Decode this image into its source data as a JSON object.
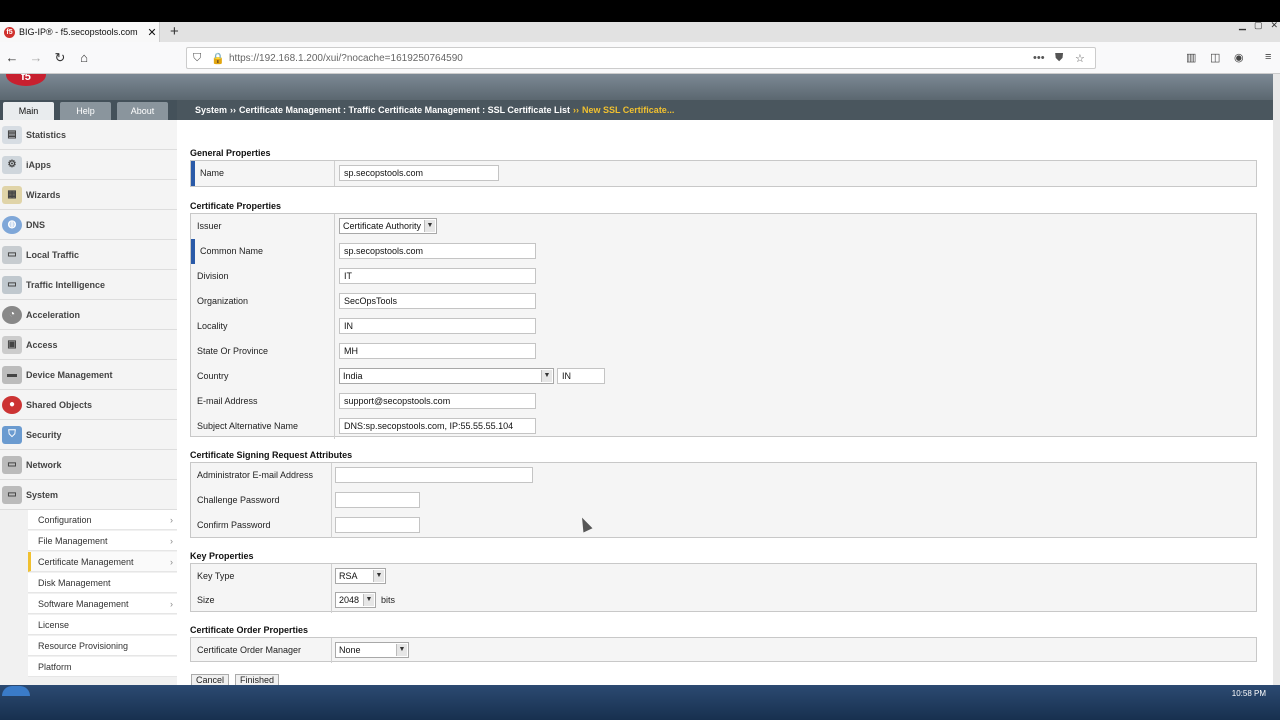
{
  "browser": {
    "tab_title": "BIG-IP® - f5.secopstools.com",
    "tab_favicon": "f5",
    "new_tab": "+",
    "url_host": "https://192.168.1.200",
    "url_path": "/xui/?nocache=1619250764590"
  },
  "app": {
    "logo_text": "f5",
    "nav_tabs": [
      "Main",
      "Help",
      "About"
    ],
    "breadcrumb": {
      "part1": "System",
      "sep": "››",
      "part2": "Certificate Management : Traffic Certificate Management : SSL Certificate List",
      "current": "New SSL Certificate..."
    }
  },
  "sidebar": {
    "items": [
      "Statistics",
      "iApps",
      "Wizards",
      "DNS",
      "Local Traffic",
      "Traffic Intelligence",
      "Acceleration",
      "Access",
      "Device Management",
      "Shared Objects",
      "Security",
      "Network",
      "System"
    ],
    "submenu": [
      "Configuration",
      "File Management",
      "Certificate Management",
      "Disk Management",
      "Software Management",
      "License",
      "Resource Provisioning",
      "Platform"
    ]
  },
  "form": {
    "general_title": "General Properties",
    "name_label": "Name",
    "name_value": "sp.secopstools.com",
    "cert_title": "Certificate Properties",
    "issuer_label": "Issuer",
    "issuer_value": "Certificate Authority",
    "common_name_label": "Common Name",
    "common_name_value": "sp.secopstools.com",
    "division_label": "Division",
    "division_value": "IT",
    "organization_label": "Organization",
    "organization_value": "SecOpsTools",
    "locality_label": "Locality",
    "locality_value": "IN",
    "state_label": "State Or Province",
    "state_value": "MH",
    "country_label": "Country",
    "country_value": "India",
    "country_code": "IN",
    "email_label": "E-mail Address",
    "email_value": "support@secopstools.com",
    "san_label": "Subject Alternative Name",
    "san_value": "DNS:sp.secopstools.com, IP:55.55.55.104",
    "csr_title": "Certificate Signing Request Attributes",
    "admin_email_label": "Administrator E-mail Address",
    "challenge_label": "Challenge Password",
    "confirm_label": "Confirm Password",
    "key_title": "Key Properties",
    "key_type_label": "Key Type",
    "key_type_value": "RSA",
    "size_label": "Size",
    "size_value": "2048",
    "size_unit": "bits",
    "order_title": "Certificate Order Properties",
    "order_manager_label": "Certificate Order Manager",
    "order_manager_value": "None",
    "cancel_label": "Cancel",
    "finished_label": "Finished"
  },
  "taskbar": {
    "clock": "10:58 PM"
  },
  "colors": {
    "accent": "#f0c030",
    "required_marker": "#2a5aa8",
    "banner": "#5b6770"
  }
}
